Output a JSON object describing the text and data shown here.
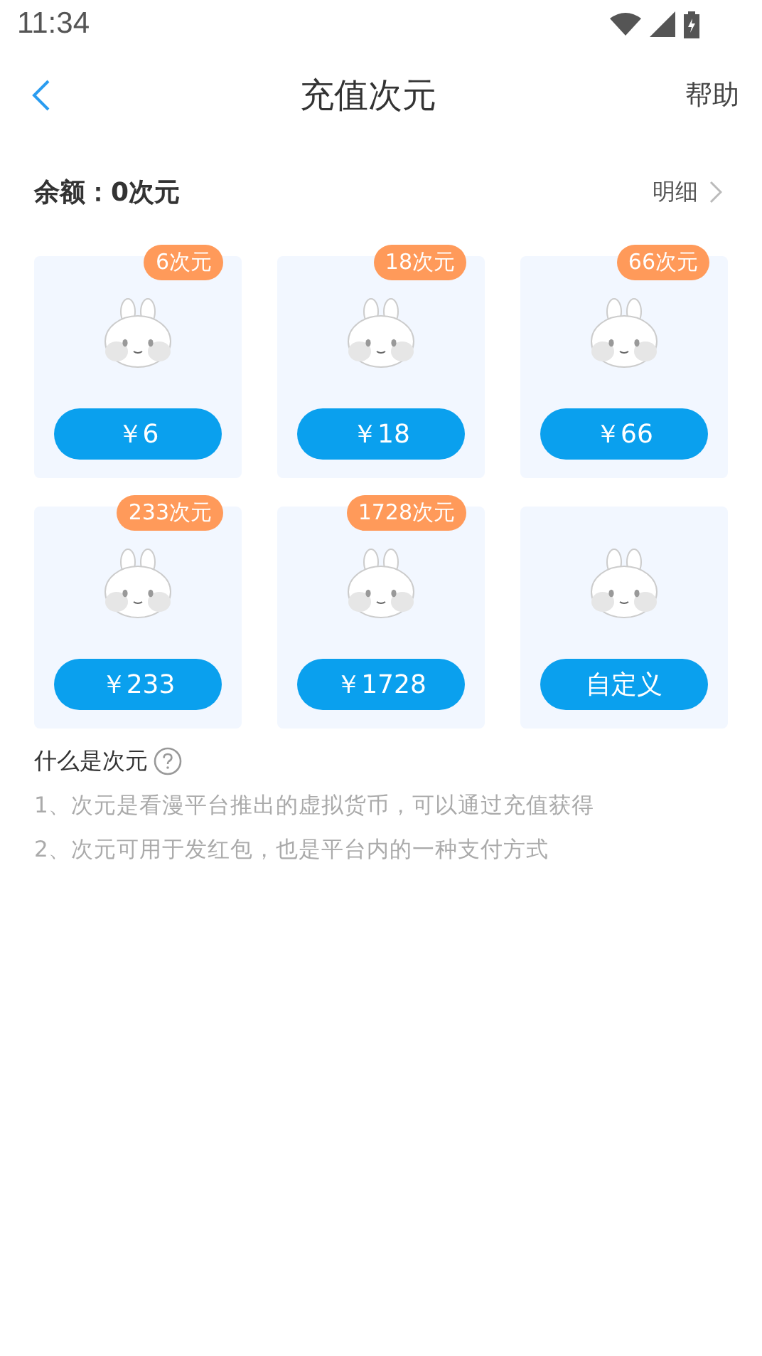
{
  "status_bar": {
    "time": "11:34"
  },
  "header": {
    "title": "充值次元",
    "action": "帮助"
  },
  "balance": {
    "label": "余额：0次元",
    "detail_link": "明细"
  },
  "packages": [
    {
      "badge": "6次元",
      "button": "￥6"
    },
    {
      "badge": "18次元",
      "button": "￥18"
    },
    {
      "badge": "66次元",
      "button": "￥66"
    },
    {
      "badge": "233次元",
      "button": "￥233"
    },
    {
      "badge": "1728次元",
      "button": "￥1728"
    },
    {
      "button": "自定义"
    }
  ],
  "info": {
    "title": "什么是次元",
    "lines": [
      "1、次元是看漫平台推出的虚拟货币，可以通过充值获得",
      "2、次元可用于发红包，也是平台内的一种支付方式"
    ]
  }
}
